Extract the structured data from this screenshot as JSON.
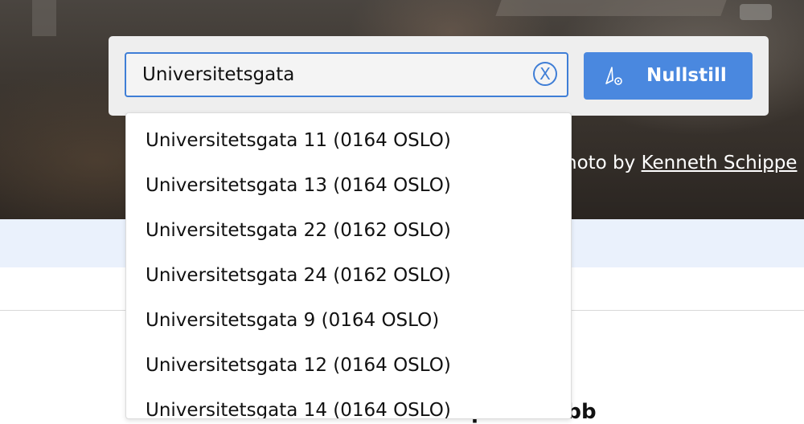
{
  "hero": {
    "photo_credit_prefix": "hoto by ",
    "photo_credit_author": "Kenneth Schippe"
  },
  "search": {
    "value": "Universitetsgata",
    "clear_icon": "close-circle-icon",
    "reset_label": "Nullstill",
    "reset_icon": "location-arrow-icon",
    "suggestions": [
      "Universitetsgata 11 (0164 OSLO)",
      "Universitetsgata 13 (0164 OSLO)",
      "Universitetsgata 22 (0162 OSLO)",
      "Universitetsgata 24 (0162 OSLO)",
      "Universitetsgata 9 (0164 OSLO)",
      "Universitetsgata 12 (0164 OSLO)",
      "Universitetsgata 14 (0164 OSLO)"
    ]
  },
  "page": {
    "club_title": "Enebakk Motorsport Klubb"
  },
  "colors": {
    "accent": "#4a88df",
    "input_border": "#3f7ed6",
    "band": "#eaf1fc"
  }
}
